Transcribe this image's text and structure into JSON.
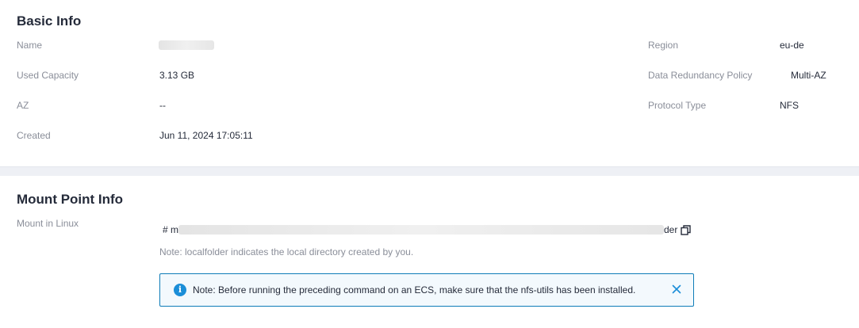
{
  "basic_info": {
    "title": "Basic Info",
    "left": [
      {
        "label": "Name",
        "value": ""
      },
      {
        "label": "Used Capacity",
        "value": "3.13 GB"
      },
      {
        "label": "AZ",
        "value": "--"
      },
      {
        "label": "Created",
        "value": "Jun 11, 2024 17:05:11"
      }
    ],
    "right": [
      {
        "label": "Region",
        "value": "eu-de"
      },
      {
        "label": "Data Redundancy Policy",
        "value": "Multi-AZ"
      },
      {
        "label": "Protocol Type",
        "value": "NFS"
      }
    ]
  },
  "mount_info": {
    "title": "Mount Point Info",
    "label": "Mount in Linux",
    "command_prefix": "# m",
    "command_suffix": "der",
    "note": "Note: localfolder indicates the local directory created by you.",
    "alert": "Note: Before running the preceding command on an ECS, make sure that the nfs-utils has been installed."
  },
  "icons": {
    "copy": "copy-icon",
    "info": "info-icon",
    "close": "close-icon"
  },
  "colors": {
    "accent": "#1b8ed8",
    "alert_border": "#0e7cb8",
    "alert_bg": "#f3f9fd",
    "label": "#8a8e99",
    "text": "#252b3a"
  }
}
